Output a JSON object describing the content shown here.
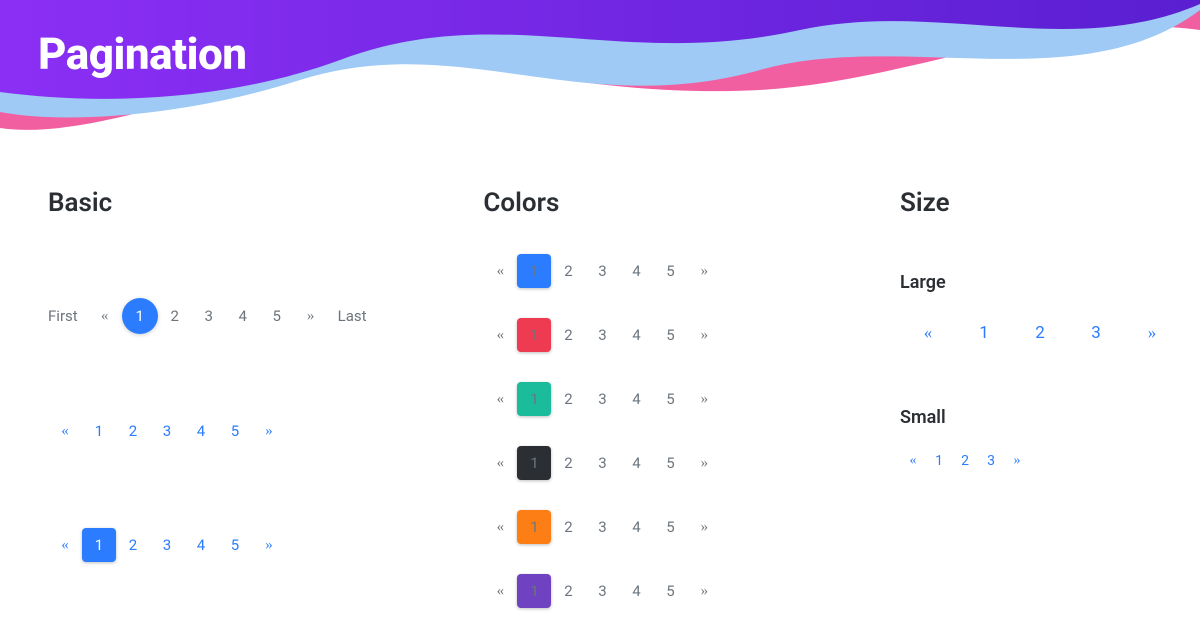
{
  "title": "Pagination",
  "sections": {
    "basic": {
      "heading": "Basic"
    },
    "colors": {
      "heading": "Colors"
    },
    "size": {
      "heading": "Size",
      "large_label": "Large",
      "small_label": "Small"
    }
  },
  "glyphs": {
    "first": "First",
    "last": "Last",
    "prev": "«",
    "next": "»"
  },
  "basic_row1": {
    "active": "1",
    "p2": "2",
    "p3": "3",
    "p4": "4",
    "p5": "5"
  },
  "basic_row2": {
    "p1": "1",
    "p2": "2",
    "p3": "3",
    "p4": "4",
    "p5": "5"
  },
  "basic_row3": {
    "active": "1",
    "p2": "2",
    "p3": "3",
    "p4": "4",
    "p5": "5"
  },
  "colors_rows": {
    "blue": {
      "active": "1",
      "p2": "2",
      "p3": "3",
      "p4": "4",
      "p5": "5"
    },
    "red": {
      "active": "1",
      "p2": "2",
      "p3": "3",
      "p4": "4",
      "p5": "5"
    },
    "teal": {
      "active": "1",
      "p2": "2",
      "p3": "3",
      "p4": "4",
      "p5": "5"
    },
    "dark": {
      "active": "1",
      "p2": "2",
      "p3": "3",
      "p4": "4",
      "p5": "5"
    },
    "orange": {
      "active": "1",
      "p2": "2",
      "p3": "3",
      "p4": "4",
      "p5": "5"
    },
    "purple": {
      "active": "1",
      "p2": "2",
      "p3": "3",
      "p4": "4",
      "p5": "5"
    }
  },
  "size_large": {
    "p1": "1",
    "p2": "2",
    "p3": "3"
  },
  "size_small": {
    "p1": "1",
    "p2": "2",
    "p3": "3"
  },
  "palette": {
    "blue": "#2b7cff",
    "red": "#ef3b52",
    "teal": "#1abc9c",
    "dark": "#2b2f33",
    "orange": "#fd7e14",
    "purple": "#6f42c1",
    "wave_purple_a": "#8b2ff5",
    "wave_purple_b": "#5a1fd1",
    "wave_blue": "#9ecaf5",
    "wave_pink": "#f25fa1"
  }
}
